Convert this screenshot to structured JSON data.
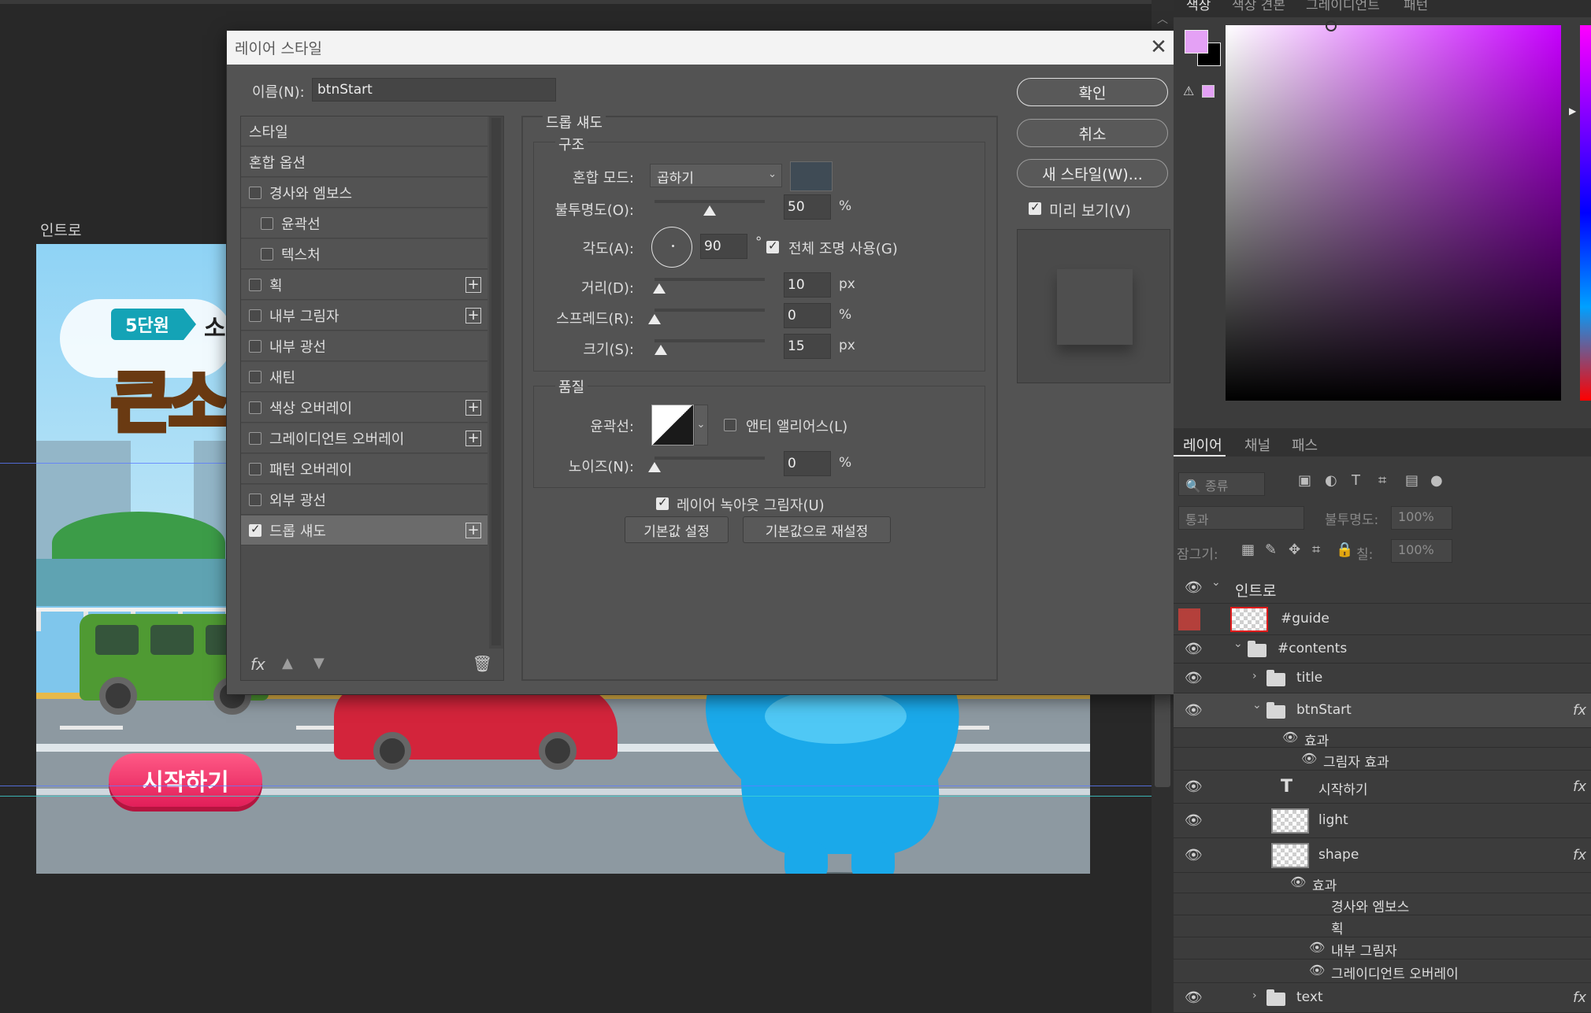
{
  "canvas": {
    "artboard_label": "인트로",
    "unit_badge": "5단원",
    "title_part": "소",
    "big_title": "큰소리",
    "start_button": "시작하기"
  },
  "dialog": {
    "title": "레이어 스타일",
    "close_icon": "close-icon",
    "name_label": "이름(N):",
    "name_value": "btnStart",
    "style_list": [
      {
        "label": "스타일",
        "type": "header"
      },
      {
        "label": "혼합 옵션",
        "type": "header"
      },
      {
        "label": "경사와 엠보스",
        "checked": false
      },
      {
        "label": "윤곽선",
        "checked": false,
        "sub": true
      },
      {
        "label": "텍스처",
        "checked": false,
        "sub": true
      },
      {
        "label": "획",
        "checked": false,
        "plus": true
      },
      {
        "label": "내부 그림자",
        "checked": false,
        "plus": true
      },
      {
        "label": "내부 광선",
        "checked": false
      },
      {
        "label": "새틴",
        "checked": false
      },
      {
        "label": "색상 오버레이",
        "checked": false,
        "plus": true
      },
      {
        "label": "그레이디언트 오버레이",
        "checked": false,
        "plus": true
      },
      {
        "label": "패턴 오버레이",
        "checked": false
      },
      {
        "label": "외부 광선",
        "checked": false
      },
      {
        "label": "드롭 섀도",
        "checked": true,
        "plus": true,
        "selected": true
      }
    ],
    "list_footer": {
      "fx": "fx",
      "up_icon": "arrow-up-icon",
      "down_icon": "arrow-down-icon",
      "trash_icon": "trash-icon"
    },
    "drop_shadow": {
      "group_title": "드롭 섀도",
      "structure_title": "구조",
      "blend_mode_label": "혼합 모드:",
      "blend_mode_value": "곱하기",
      "shadow_color": "#3f4b55",
      "opacity_label": "불투명도(O):",
      "opacity_value": "50",
      "opacity_unit": "%",
      "opacity_fraction": 0.5,
      "angle_label": "각도(A):",
      "angle_value": "90",
      "angle_unit": "°",
      "global_light_label": "전체 조명 사용(G)",
      "global_light_checked": true,
      "distance_label": "거리(D):",
      "distance_value": "10",
      "distance_unit": "px",
      "distance_fraction": 0.04,
      "spread_label": "스프레드(R):",
      "spread_value": "0",
      "spread_unit": "%",
      "spread_fraction": 0,
      "size_label": "크기(S):",
      "size_value": "15",
      "size_unit": "px",
      "size_fraction": 0.06,
      "quality_title": "품질",
      "contour_label": "윤곽선:",
      "antialias_label": "앤티 앨리어스(L)",
      "antialias_checked": false,
      "noise_label": "노이즈(N):",
      "noise_value": "0",
      "noise_unit": "%",
      "noise_fraction": 0,
      "knockout_label": "레이어 녹아웃 그림자(U)",
      "knockout_checked": true,
      "make_default": "기본값 설정",
      "reset_default": "기본값으로 재설정"
    },
    "buttons": {
      "ok": "확인",
      "cancel": "취소",
      "new_style": "새 스타일(W)...",
      "preview_label": "미리 보기(V)",
      "preview_checked": true
    }
  },
  "color_panel": {
    "tabs": [
      "색상",
      "색상 견본",
      "그레이디언트",
      "패턴"
    ],
    "foreground": "#e4a1f5",
    "background": "#000000"
  },
  "layers_panel": {
    "tabs": [
      "레이어",
      "채널",
      "패스"
    ],
    "filter_placeholder": "종류",
    "blend_mode": "통과",
    "opacity_label": "불투명도:",
    "opacity_value": "100%",
    "lock_label": "잠그기:",
    "fill_label": "칠:",
    "fill_value": "100%",
    "rows": [
      {
        "name": "인트로",
        "kind": "artboard"
      },
      {
        "name": "#guide",
        "kind": "smart"
      },
      {
        "name": "#contents",
        "kind": "folder"
      },
      {
        "name": "title",
        "kind": "folder"
      },
      {
        "name": "btnStart",
        "kind": "folder",
        "fx": true
      },
      {
        "name": "효과",
        "kind": "effects"
      },
      {
        "name": "그림자 효과",
        "kind": "effect"
      },
      {
        "name": "시작하기",
        "kind": "text",
        "fx": true
      },
      {
        "name": "light",
        "kind": "smart"
      },
      {
        "name": "shape",
        "kind": "smart",
        "fx": true
      },
      {
        "name": "효과",
        "kind": "effects"
      },
      {
        "name": "경사와 엠보스",
        "kind": "effect-hidden"
      },
      {
        "name": "획",
        "kind": "effect-hidden"
      },
      {
        "name": "내부 그림자",
        "kind": "effect"
      },
      {
        "name": "그레이디언트 오버레이",
        "kind": "effect"
      },
      {
        "name": "text",
        "kind": "folder",
        "fx": true
      }
    ],
    "fx_mark": "fx"
  }
}
